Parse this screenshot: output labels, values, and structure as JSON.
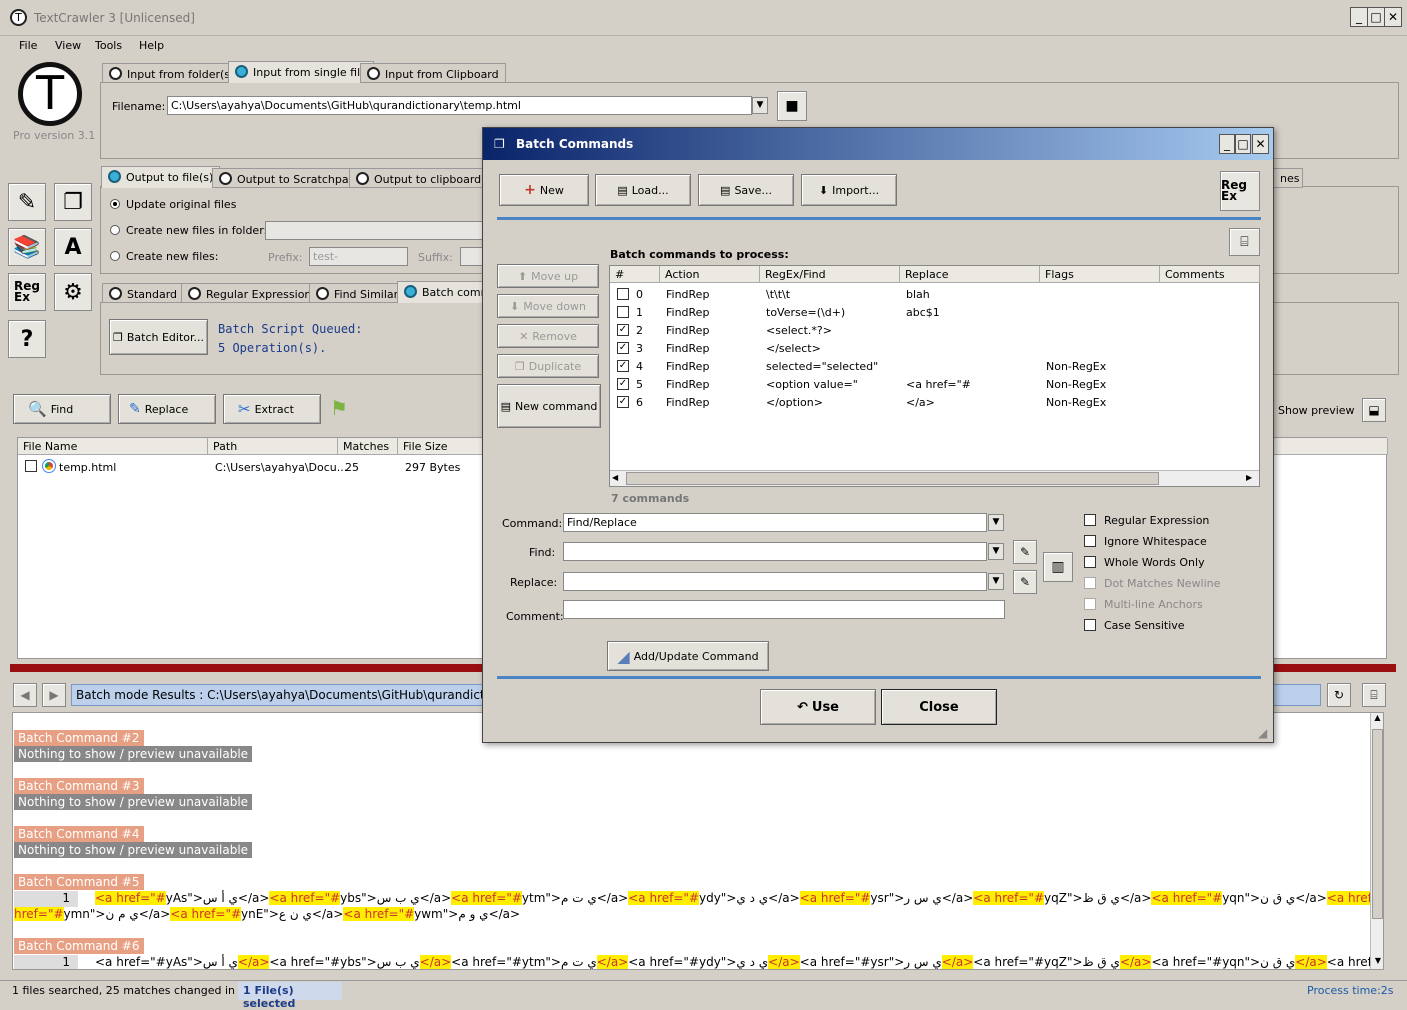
{
  "app": {
    "title": "TextCrawler 3 [Unlicensed]",
    "logo_letter": "T",
    "version": "Pro version 3.1",
    "min": "_",
    "max": "□",
    "close": "✕"
  },
  "menu": [
    "File",
    "View",
    "Tools",
    "Help"
  ],
  "input_tabs": [
    "Input from folder(s)",
    "Input from single file",
    "Input from Clipboard"
  ],
  "filename": {
    "label": "Filename:",
    "value": "C:\\Users\\ayahya\\Documents\\GitHub\\qurandictionary\\temp.html"
  },
  "output_tabs": [
    "Output to file(s)",
    "Output to Scratchpad",
    "Output to clipboard"
  ],
  "output_opts": {
    "update": "Update original files",
    "new_folder": "Create new files in folder:",
    "new_files": "Create new files:",
    "prefix_label": "Prefix:",
    "prefix_value": "test-",
    "suffix_label": "Suffix:",
    "lines_tab": "nes"
  },
  "mode_tabs": [
    "Standard",
    "Regular Expression",
    "Find Similar",
    "Batch comm"
  ],
  "batch": {
    "editor_btn": "Batch Editor...",
    "queued_line1": "Batch Script Queued:",
    "queued_line2": "5 Operation(s)."
  },
  "action_buttons": {
    "find": "Find",
    "replace": "Replace",
    "extract": "Extract",
    "show_preview": "Show preview"
  },
  "file_table": {
    "headers": [
      "File Name",
      "Path",
      "Matches",
      "File Size"
    ],
    "rows": [
      {
        "name": "temp.html",
        "path": "C:\\Users\\ayahya\\Docu...",
        "matches": "25",
        "size": "297 Bytes"
      }
    ]
  },
  "results_bar": "Batch mode Results : C:\\Users\\ayahya\\Documents\\GitHub\\qurandictionary",
  "results": {
    "blocks": [
      {
        "tag": "Batch Command #2",
        "note": "Nothing to show / preview unavailable"
      },
      {
        "tag": "Batch Command #3",
        "note": "Nothing to show / preview unavailable"
      },
      {
        "tag": "Batch Command #4",
        "note": "Nothing to show / preview unavailable"
      },
      {
        "tag": "Batch Command #5",
        "note": ""
      },
      {
        "tag": "Batch Command #6",
        "note": ""
      }
    ],
    "line_no": "1"
  },
  "status": {
    "left": "1 files searched, 25 matches changed in 1 file",
    "selected": "1 File(s) selected",
    "right": "Process time:2s"
  },
  "dialog": {
    "title": "Batch Commands",
    "toolbar": [
      "New",
      "Load...",
      "Save...",
      "Import..."
    ],
    "regex_logo": "Reg Ex",
    "side_buttons": [
      "Move up",
      "Move down",
      "Remove",
      "Duplicate",
      "New command"
    ],
    "list_label": "Batch commands to process:",
    "headers": [
      "#",
      "Action",
      "RegEx/Find",
      "Replace",
      "Flags",
      "Comments"
    ],
    "rows": [
      {
        "checked": false,
        "n": "0",
        "action": "FindRep",
        "find": "\\t\\t\\t",
        "replace": "blah",
        "flags": ""
      },
      {
        "checked": false,
        "n": "1",
        "action": "FindRep",
        "find": "toVerse=(\\d+)",
        "replace": "abc$1",
        "flags": ""
      },
      {
        "checked": true,
        "n": "2",
        "action": "FindRep",
        "find": "<select.*?>",
        "replace": "",
        "flags": ""
      },
      {
        "checked": true,
        "n": "3",
        "action": "FindRep",
        "find": "</select>",
        "replace": "",
        "flags": ""
      },
      {
        "checked": true,
        "n": "4",
        "action": "FindRep",
        "find": "selected=\"selected\"",
        "replace": "",
        "flags": "Non-RegEx"
      },
      {
        "checked": true,
        "n": "5",
        "action": "FindRep",
        "find": "<option value=\"",
        "replace": "<a href=\"#",
        "flags": "Non-RegEx"
      },
      {
        "checked": true,
        "n": "6",
        "action": "FindRep",
        "find": "</option>",
        "replace": "</a>",
        "flags": "Non-RegEx"
      }
    ],
    "count": "7 commands",
    "form": {
      "command_label": "Command:",
      "command_value": "Find/Replace",
      "find_label": "Find:",
      "replace_label": "Replace:",
      "comment_label": "Comment:"
    },
    "options": [
      {
        "label": "Regular Expression",
        "enabled": true
      },
      {
        "label": "Ignore Whitespace",
        "enabled": true
      },
      {
        "label": "Whole Words Only",
        "enabled": true
      },
      {
        "label": "Dot Matches Newline",
        "enabled": false
      },
      {
        "label": "Multi-line Anchors",
        "enabled": false
      },
      {
        "label": "Case Sensitive",
        "enabled": true
      }
    ],
    "add_btn": "Add/Update Command",
    "use_btn": "Use",
    "close_btn": "Close"
  }
}
